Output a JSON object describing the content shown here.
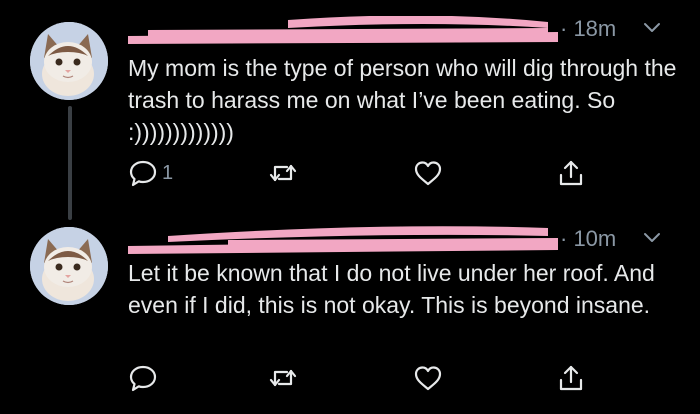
{
  "tweets": [
    {
      "time": "· 18m",
      "text": "My mom is the type of person who will dig through the trash to harass me on what I’ve been eating. So :)))))))))))))",
      "reply_count": "1"
    },
    {
      "time": "· 10m",
      "text": "Let it be known that I do not live under her roof. And even if I did, this is not okay. This is beyond insane.",
      "reply_count": ""
    }
  ],
  "icons": {
    "reply": "reply-icon",
    "retweet": "retweet-icon",
    "like": "heart-icon",
    "share": "share-icon",
    "more": "chevron-down-icon"
  },
  "colors": {
    "background": "#000000",
    "text": "#e7e9ea",
    "muted": "#8b98a5",
    "redaction": "#f2a7c3"
  }
}
